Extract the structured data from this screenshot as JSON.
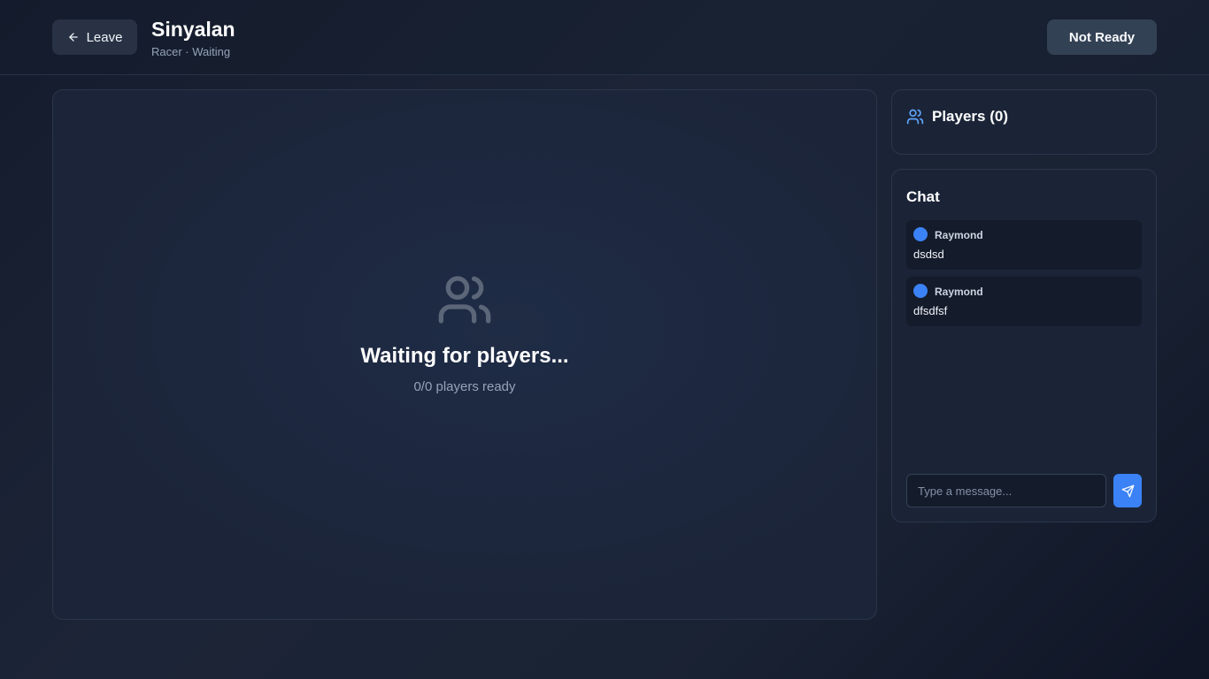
{
  "header": {
    "leave_label": "Leave",
    "leave_icon": "arrow-left-icon",
    "room_name": "Sinyalan",
    "room_subtitle": "Racer · Waiting",
    "ready_label": "Not Ready"
  },
  "stage": {
    "icon": "users-icon",
    "title": "Waiting for players...",
    "ready_count": "0/0 players ready"
  },
  "players_panel": {
    "icon": "users-icon",
    "title": "Players (0)"
  },
  "chat": {
    "title": "Chat",
    "messages": [
      {
        "author": "Raymond",
        "text": "dsdsd"
      },
      {
        "author": "Raymond",
        "text": "dfsdfsf"
      }
    ],
    "input_placeholder": "Type a message...",
    "send_icon": "send-icon"
  },
  "colors": {
    "accent": "#3b82f6",
    "background": "#1b2437",
    "muted_text": "#94a3b8"
  }
}
